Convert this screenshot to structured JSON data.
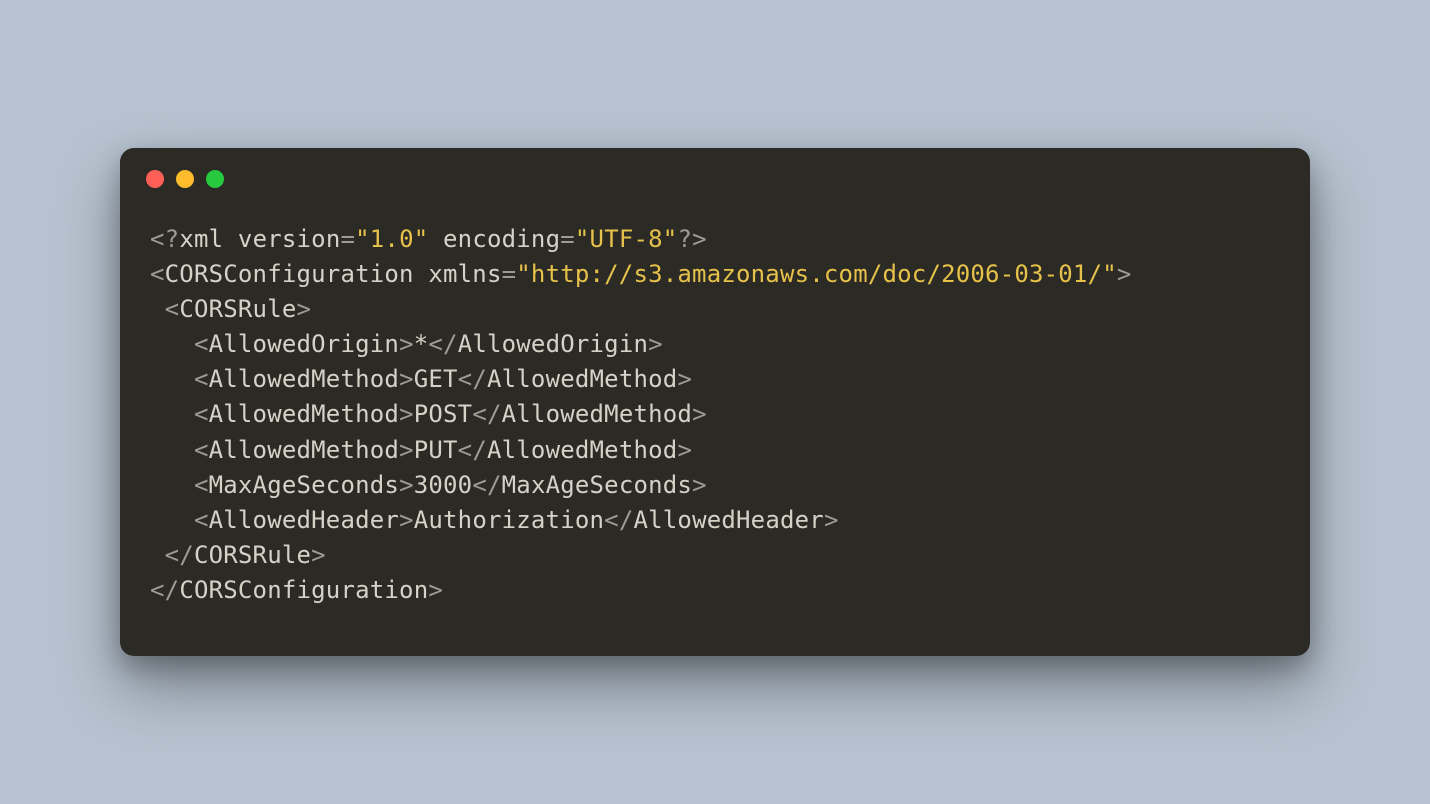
{
  "code": {
    "xml_decl": {
      "open": "<?",
      "name": "xml",
      "attr1": "version",
      "val1": "\"1.0\"",
      "attr2": "encoding",
      "val2": "\"UTF-8\"",
      "close": "?>"
    },
    "root_open": {
      "open": "<",
      "name": "CORSConfiguration",
      "attr": "xmlns",
      "eq": "=",
      "val": "\"http://s3.amazonaws.com/doc/2006-03-01/\"",
      "close": ">"
    },
    "rule_open": {
      "open": " <",
      "name": "CORSRule",
      "close": ">"
    },
    "origin": {
      "open": "   <",
      "name": "AllowedOrigin",
      "mid": ">",
      "text": "*",
      "copen": "</",
      "cname": "AllowedOrigin",
      "cclose": ">"
    },
    "m_get": {
      "open": "   <",
      "name": "AllowedMethod",
      "mid": ">",
      "text": "GET",
      "copen": "</",
      "cname": "AllowedMethod",
      "cclose": ">"
    },
    "m_post": {
      "open": "   <",
      "name": "AllowedMethod",
      "mid": ">",
      "text": "POST",
      "copen": "</",
      "cname": "AllowedMethod",
      "cclose": ">"
    },
    "m_put": {
      "open": "   <",
      "name": "AllowedMethod",
      "mid": ">",
      "text": "PUT",
      "copen": "</",
      "cname": "AllowedMethod",
      "cclose": ">"
    },
    "maxage": {
      "open": "   <",
      "name": "MaxAgeSeconds",
      "mid": ">",
      "text": "3000",
      "copen": "</",
      "cname": "MaxAgeSeconds",
      "cclose": ">"
    },
    "header": {
      "open": "   <",
      "name": "AllowedHeader",
      "mid": ">",
      "text": "Authorization",
      "copen": "</",
      "cname": "AllowedHeader",
      "cclose": ">"
    },
    "rule_close": {
      "open": " </",
      "name": "CORSRule",
      "close": ">"
    },
    "root_close": {
      "open": "</",
      "name": "CORSConfiguration",
      "close": ">"
    }
  }
}
